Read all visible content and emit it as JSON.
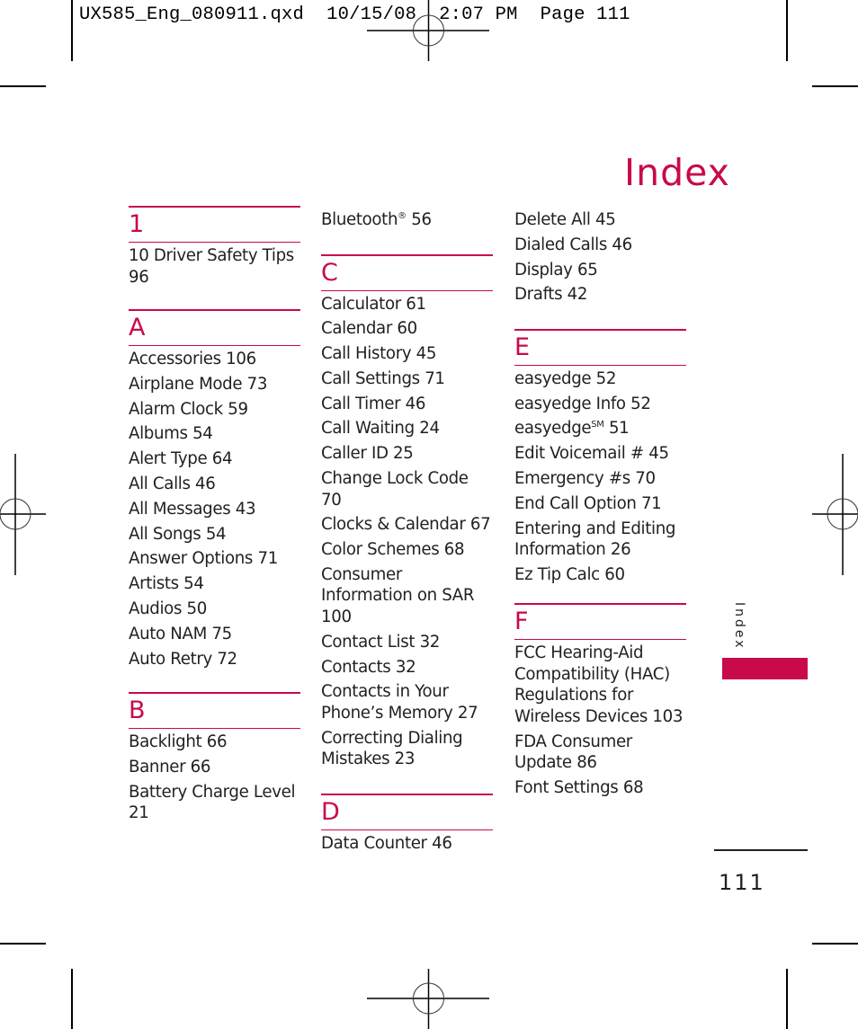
{
  "slug": {
    "filename": "UX585_Eng_080911.qxd",
    "date": "10/15/08",
    "time": "2:07 PM",
    "page_label": "Page 111"
  },
  "title": "Index",
  "accent_color": "#c8094a",
  "side_tab_label": "Index",
  "page_number": "111",
  "columns": [
    {
      "sections": [
        {
          "letter": "1",
          "entries": [
            "10 Driver Safety Tips 96"
          ]
        },
        {
          "letter": "A",
          "entries": [
            "Accessories 106",
            "Airplane Mode 73",
            "Alarm Clock 59",
            "Albums 54",
            "Alert Type 64",
            "All Calls 46",
            "All Messages 43",
            "All Songs 54",
            "Answer Options 71",
            "Artists 54",
            "Audios 50",
            "Auto NAM 75",
            "Auto Retry 72"
          ]
        },
        {
          "letter": "B",
          "entries": [
            "Backlight 66",
            "Banner 66",
            "Battery Charge Level 21"
          ]
        }
      ]
    },
    {
      "continued_entries": [
        {
          "text": "Bluetooth",
          "sup": "®",
          "page": "56"
        }
      ],
      "sections": [
        {
          "letter": "C",
          "entries": [
            "Calculator 61",
            "Calendar 60",
            "Call History 45",
            "Call Settings 71",
            "Call Timer 46",
            "Call Waiting 24",
            "Caller ID 25",
            "Change Lock Code 70",
            "Clocks & Calendar 67",
            "Color Schemes 68",
            "Consumer Information on SAR 100",
            "Contact List 32",
            "Contacts 32",
            "Contacts in Your Phone’s Memory 27",
            "Correcting Dialing Mistakes 23"
          ]
        },
        {
          "letter": "D",
          "entries": [
            "Data Counter 46"
          ]
        }
      ]
    },
    {
      "continued_entries": [
        "Delete All 45",
        "Dialed Calls 46",
        "Display 65",
        "Drafts 42"
      ],
      "sections": [
        {
          "letter": "E",
          "entries": [
            "easyedge 52",
            "easyedge Info 52",
            {
              "text": "easyedge",
              "sup": "SM",
              "page": "51"
            },
            "Edit Voicemail # 45",
            "Emergency #s 70",
            "End Call Option 71",
            "Entering and Editing Information 26",
            "Ez Tip Calc 60"
          ]
        },
        {
          "letter": "F",
          "entries": [
            "FCC Hearing-Aid Compatibility (HAC) Regulations for Wireless Devices 103",
            "FDA Consumer Update 86",
            "Font Settings 68"
          ]
        }
      ]
    }
  ]
}
